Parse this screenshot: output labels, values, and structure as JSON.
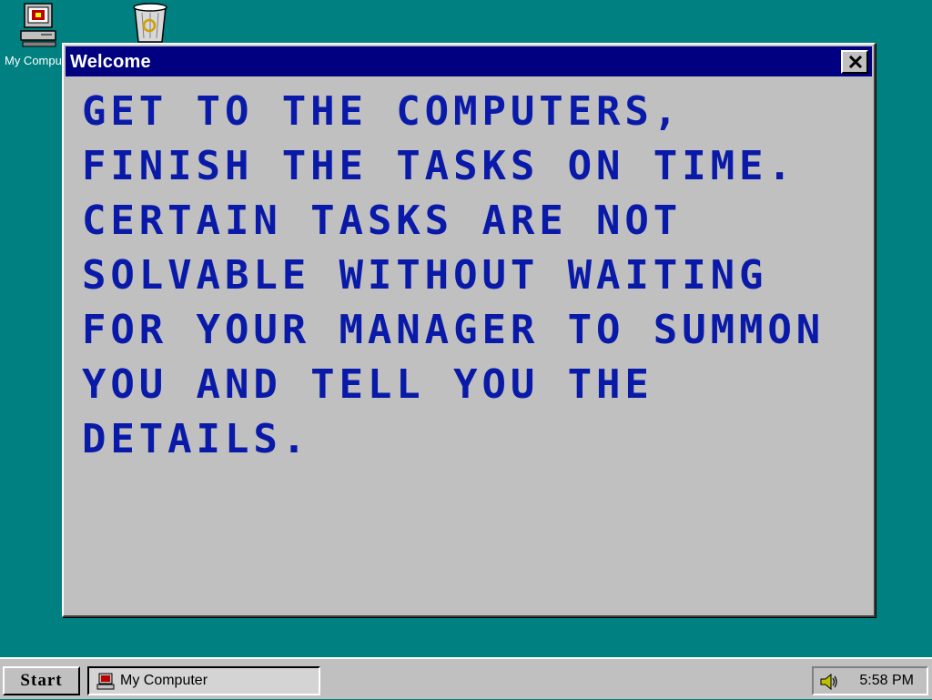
{
  "desktop": {
    "icons": [
      {
        "label": "My Computer",
        "icon": "my-computer-icon"
      },
      {
        "label": "",
        "icon": "recycle-bin-icon"
      }
    ]
  },
  "window": {
    "title": "Welcome",
    "close_icon": "close-icon",
    "message": "Get to the computers, finish the tasks on time. Certain tasks are not solvable without waiting for your manager to summon you and tell you the details."
  },
  "taskbar": {
    "start_label": "Start",
    "tasks": [
      {
        "label": "My Computer",
        "icon": "my-computer-icon"
      }
    ],
    "tray": {
      "volume_icon": "speaker-icon",
      "clock": "5:58 PM"
    }
  },
  "colors": {
    "desktop": "#008080",
    "title_bar": "#000080",
    "window_face": "#c0c0c0",
    "message_text": "#0a1aa8"
  }
}
